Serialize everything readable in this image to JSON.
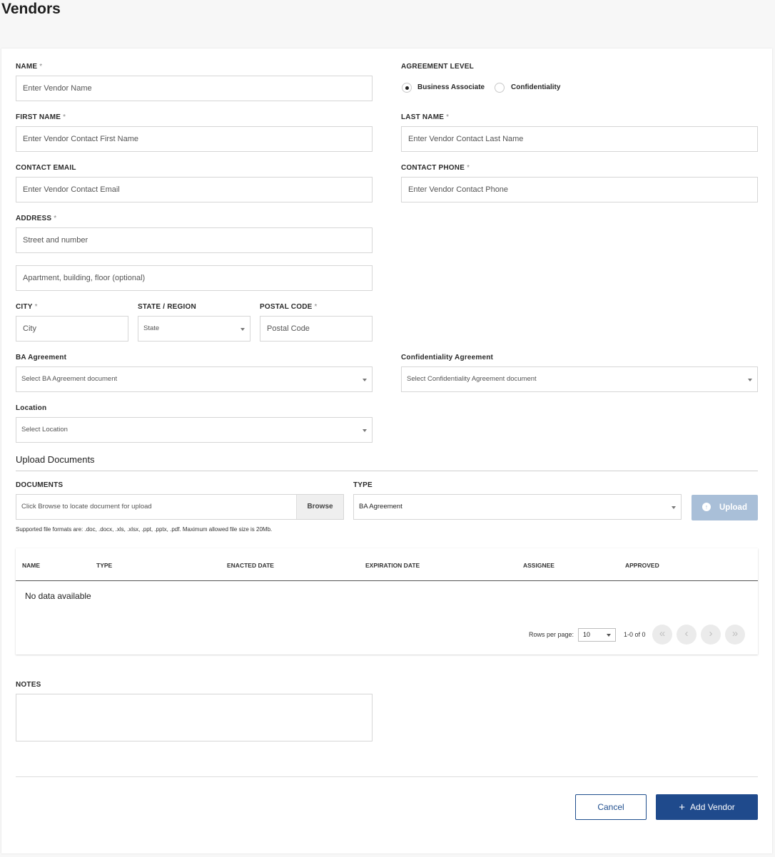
{
  "page": {
    "title": "Vendors"
  },
  "form": {
    "name": {
      "label": "NAME",
      "required": "*",
      "placeholder": "Enter Vendor Name"
    },
    "agreement_level": {
      "label": "AGREEMENT LEVEL",
      "options": [
        {
          "label": "Business Associate",
          "selected": true
        },
        {
          "label": "Confidentiality",
          "selected": false
        }
      ]
    },
    "first_name": {
      "label": "FIRST NAME",
      "required": "*",
      "placeholder": "Enter Vendor Contact First Name"
    },
    "last_name": {
      "label": "LAST NAME",
      "required": "*",
      "placeholder": "Enter Vendor Contact Last Name"
    },
    "contact_email": {
      "label": "CONTACT EMAIL",
      "placeholder": "Enter Vendor Contact Email"
    },
    "contact_phone": {
      "label": "CONTACT PHONE",
      "required": "*",
      "placeholder": "Enter Vendor Contact Phone"
    },
    "address": {
      "label": "ADDRESS",
      "required": "*",
      "line1_placeholder": "Street and number",
      "line2_placeholder": "Apartment, building, floor (optional)"
    },
    "city": {
      "label": "CITY",
      "required": "*",
      "placeholder": "City"
    },
    "state": {
      "label": "STATE / REGION",
      "placeholder": "State"
    },
    "postal_code": {
      "label": "POSTAL CODE",
      "required": "*",
      "placeholder": "Postal Code"
    },
    "ba_agreement": {
      "label": "BA Agreement",
      "placeholder": "Select BA Agreement document"
    },
    "confidentiality_agreement": {
      "label": "Confidentiality Agreement",
      "placeholder": "Select Confidentiality Agreement document"
    },
    "location": {
      "label": "Location",
      "placeholder": "Select Location"
    }
  },
  "upload": {
    "section_title": "Upload Documents",
    "documents_label": "DOCUMENTS",
    "documents_placeholder": "Click Browse to locate document for upload",
    "browse_label": "Browse",
    "type_label": "TYPE",
    "type_value": "BA Agreement",
    "upload_label": "Upload",
    "hint": "Supported file formats are: .doc, .docx, .xls, .xlsx, .ppt, .pptx, .pdf. Maximum allowed file size is 20Mb."
  },
  "table": {
    "columns": [
      "NAME",
      "TYPE",
      "ENACTED DATE",
      "EXPIRATION DATE",
      "ASSIGNEE",
      "APPROVED"
    ],
    "empty_text": "No data available",
    "rows_per_page_label": "Rows per page:",
    "rows_per_page_value": "10",
    "range_text": "1-0 of 0"
  },
  "notes": {
    "label": "NOTES"
  },
  "actions": {
    "cancel_label": "Cancel",
    "add_label": "Add Vendor",
    "add_icon": "+"
  }
}
